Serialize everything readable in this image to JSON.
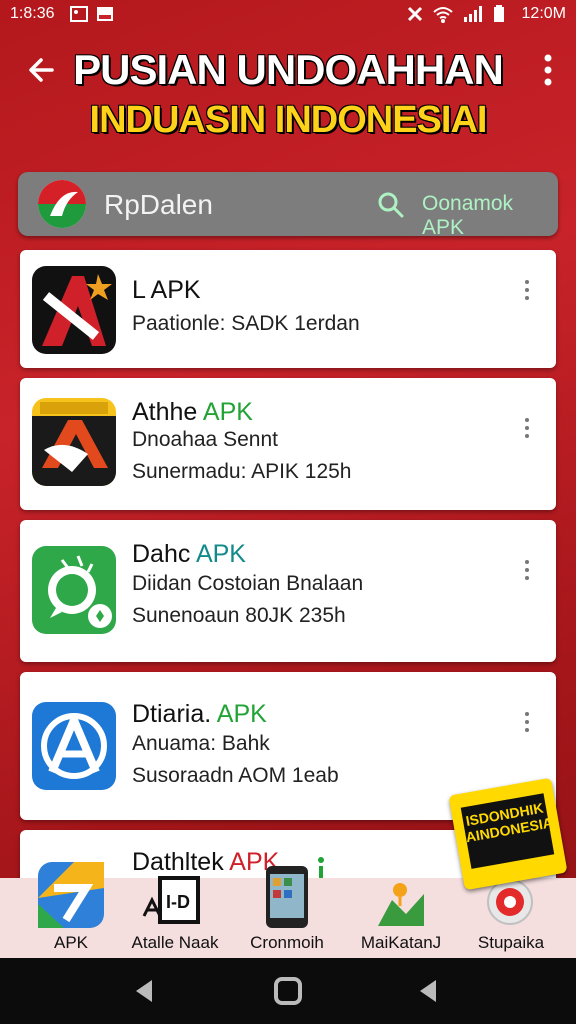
{
  "status_bar": {
    "time_left": "1:8:36",
    "time_right": "12:0M"
  },
  "header": {
    "title_line1": "PUSIAN UNDOAHHAN",
    "title_line2": "INDUASIN INDONESIAI"
  },
  "search": {
    "brand": "RpDalen",
    "placeholder": "Oonamok APK"
  },
  "apps": [
    {
      "name": "L APK",
      "apk": "",
      "line1": "Paationle: SADK 1erdan",
      "line2": ""
    },
    {
      "name": "Athhe ",
      "apk": "APK",
      "line1": "Dnoahaa Sennt",
      "line2": "Sunermadu: APIK 125h"
    },
    {
      "name": "Dahc ",
      "apk": "APK",
      "line1": "Diidan Costoian Bnalaan",
      "line2": "Sunenoaun  80JK 235h"
    },
    {
      "name": "Dtiaria. ",
      "apk": "APK",
      "line1": "Anuama: Bahk",
      "line2": "Susoraadn  AOM 1eab"
    },
    {
      "name": "Dathltek ",
      "apk": "APK",
      "line1": "",
      "line2": ""
    }
  ],
  "promo_badge": {
    "text": "ISDONDHIK AINDONESIA"
  },
  "bottom_nav": [
    {
      "label": "APK"
    },
    {
      "label": "Atalle Naak"
    },
    {
      "label": "Cronmoih"
    },
    {
      "label": "MaiKatanJ"
    },
    {
      "label": "Stupaika"
    }
  ],
  "colors": {
    "brand_red": "#c8232a",
    "apk_green": "#22a335",
    "apk_teal": "#138a8a",
    "title_yellow": "#ffd21a"
  }
}
